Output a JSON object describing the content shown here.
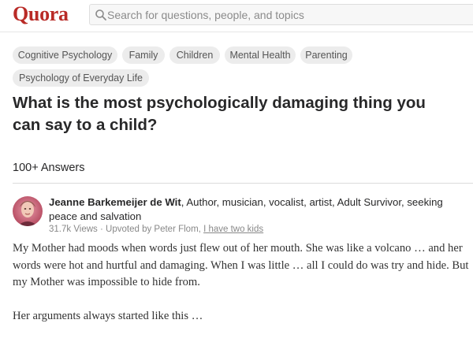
{
  "header": {
    "logo": "Quora",
    "search_placeholder": "Search for questions, people, and topics"
  },
  "topics": [
    "Cognitive Psychology",
    "Family",
    "Children",
    "Mental Health",
    "Parenting",
    "Psychology of Everyday Life"
  ],
  "question": {
    "title": "What is the most psychologically damaging thing you can say to a child?"
  },
  "answers_count": "100+ Answers",
  "answer": {
    "author_name": "Jeanne Barkemeijer de Wit",
    "author_credentials": ", Author, musician, vocalist, artist, Adult Survivor, seeking peace and salvation",
    "views": "31.7k Views",
    "upvoted_by": "Upvoted by Peter Flom,",
    "upvoter_link": "I have two kids",
    "paragraphs": [
      "My Mother had moods when words just flew out of her mouth.  She was like a volcano … and her words were hot and hurtful and damaging.  When I was little … all I could do was try and hide.  But my Mother was impossible to hide from.",
      "Her arguments always started like this …"
    ]
  },
  "colors": {
    "brand": "#b92b27",
    "tag_bg": "#ececec",
    "meta_text": "#888888"
  }
}
